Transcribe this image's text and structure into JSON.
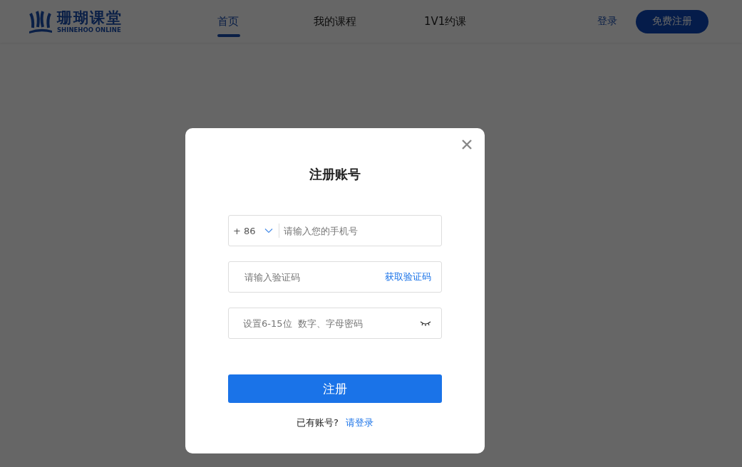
{
  "header": {
    "logo": {
      "name": "珊瑚课堂",
      "subtitle": "SHINEHOO ONLINE"
    },
    "nav": [
      {
        "label": "首页",
        "selected": true
      },
      {
        "label": "我的课程",
        "selected": false
      },
      {
        "label": "1V1约课",
        "selected": false
      }
    ],
    "login": "登录",
    "register": "免费注册"
  },
  "dialog": {
    "title": "注册账号",
    "phone": {
      "country_code": "+ 86",
      "placeholder": "请输入您的手机号"
    },
    "code": {
      "placeholder": "请输入验证码",
      "action": "获取验证码"
    },
    "password": {
      "placeholder": "设置6-15位  数字、字母密码"
    },
    "submit": "注册",
    "footer": {
      "text": "已有账号?",
      "link": "请登录"
    }
  }
}
